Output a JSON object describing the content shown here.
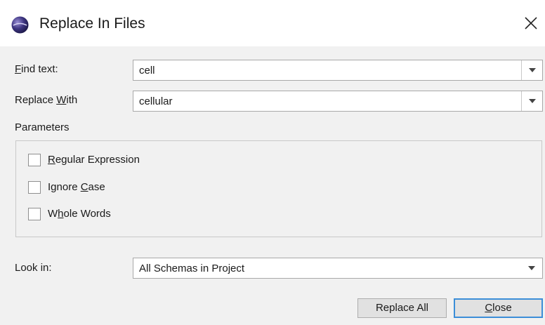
{
  "window": {
    "title": "Replace In Files",
    "close_glyph": "✕",
    "app_icon": "eclipse-sphere-icon"
  },
  "find": {
    "label_hotkey": "F",
    "label_rest": "ind text:",
    "value": "cell"
  },
  "replace": {
    "label_pre": "Replace ",
    "label_hotkey": "W",
    "label_rest": "ith",
    "value": "cellular"
  },
  "parameters": {
    "heading": "Parameters",
    "options": [
      {
        "pre": "",
        "hotkey": "R",
        "rest": "egular Expression",
        "checked": false
      },
      {
        "pre": "Ignore ",
        "hotkey": "C",
        "rest": "ase",
        "checked": false
      },
      {
        "pre": "W",
        "hotkey": "h",
        "rest": "ole Words",
        "checked": false
      }
    ]
  },
  "look_in": {
    "label": "Look in:",
    "value": "All Schemas in Project"
  },
  "buttons": {
    "replace_all": "Replace All",
    "close_hotkey": "C",
    "close_rest": "lose"
  },
  "colors": {
    "accent": "#3c8ed8",
    "dialog_bg": "#f1f1f1"
  }
}
